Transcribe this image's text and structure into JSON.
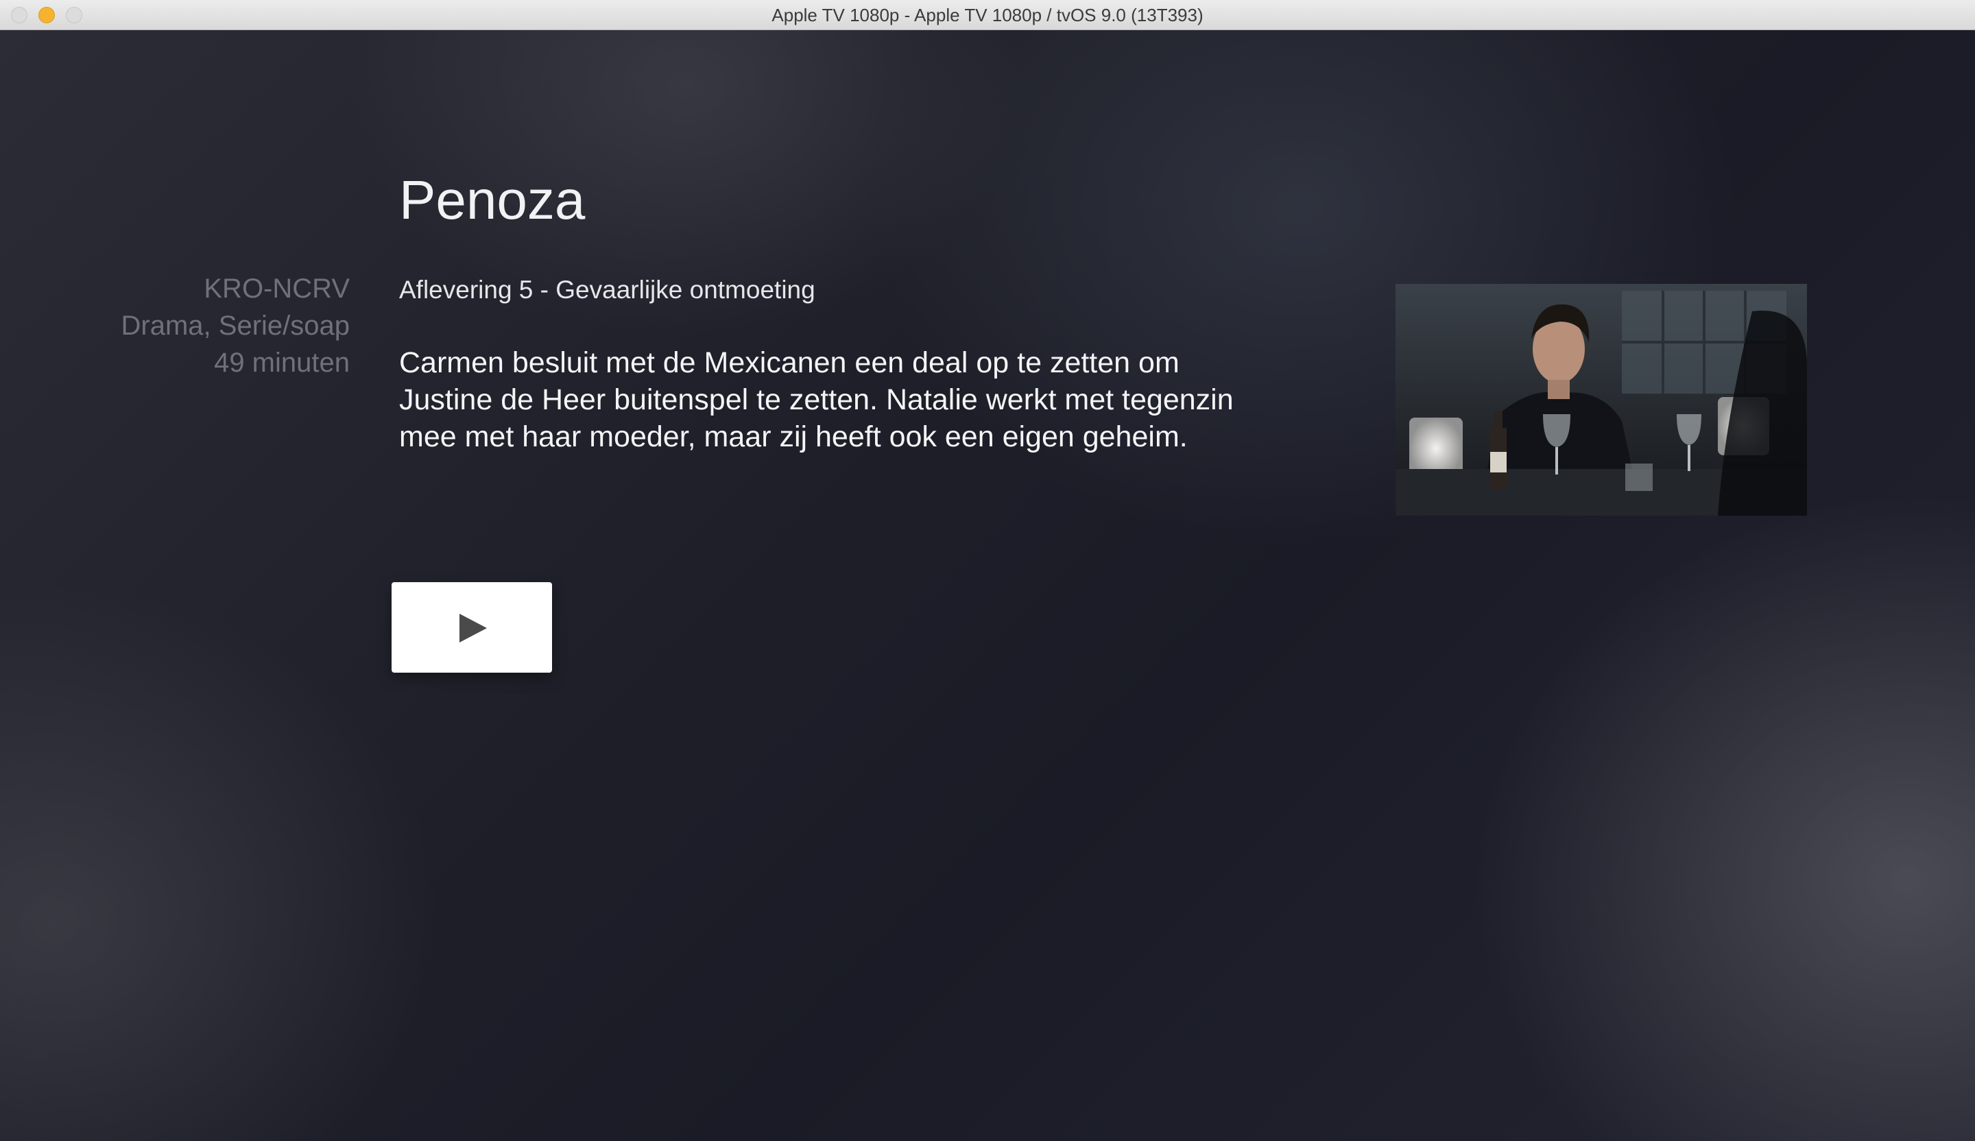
{
  "window": {
    "title": "Apple TV 1080p - Apple TV 1080p / tvOS 9.0 (13T393)"
  },
  "program": {
    "title": "Penoza",
    "broadcaster": "KRO-NCRV",
    "genre": "Drama, Serie/soap",
    "duration": "49 minuten",
    "episode_title": "Aflevering 5 - Gevaarlijke ontmoeting",
    "description": "Carmen besluit met de Mexicanen een deal op te zetten om Justine de Heer buitenspel te zetten. Natalie werkt met tegenzin mee met haar moeder, maar zij heeft ook een eigen geheim."
  },
  "play_button": {
    "icon": "play-icon"
  },
  "colors": {
    "background": "#1d1e28",
    "meta_text": "#6e717c",
    "title_text": "#f2f2f4",
    "button": "#ffffff",
    "play_icon": "#4a4a4a",
    "traffic_minimize": "#f5b330"
  }
}
